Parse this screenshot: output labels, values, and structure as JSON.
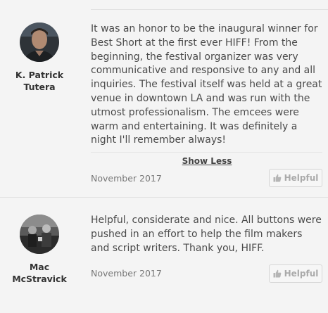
{
  "reviews": [
    {
      "author": "K. Patrick\nTutera",
      "avatar_icon": "author-photo",
      "text": "It was an honor to be the inaugural winner for Best Short at the first ever HIFF! From the beginning, the festival organizer was very communicative and responsive to any and all inquiries. The festival itself was held at a great venue in downtown LA and was run with the utmost professionalism. The emcees were warm and entertaining. It was definitely a night I'll remember always!",
      "toggle_label": "Show Less",
      "date": "November 2017",
      "helpful_label": "Helpful"
    },
    {
      "author": "Mac\nMcStravick",
      "avatar_icon": "author-photo",
      "text": "Helpful, considerate and nice. All buttons were pushed in an effort to help the film makers and script writers. Thank you, HIFF.",
      "date": "November 2017",
      "helpful_label": "Helpful"
    }
  ],
  "colors": {
    "background": "#f4f4f4",
    "text": "#4a4a4a",
    "date": "#777777",
    "button_text": "#aaaaaa",
    "button_border": "#d6d6d6"
  }
}
